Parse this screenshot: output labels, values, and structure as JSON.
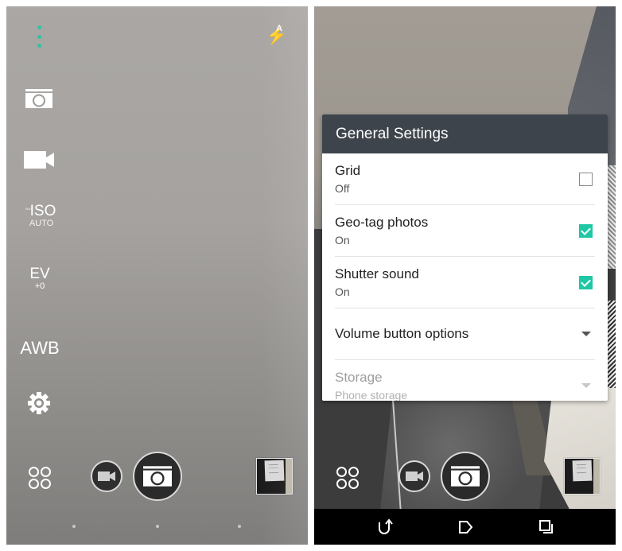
{
  "left_screen": {
    "top_bar": {
      "menu_icon": "vertical-dots-icon",
      "flash_icon": "flash-auto-icon",
      "flash_label": "A",
      "flash_glyph": "⚡"
    },
    "side_menu": {
      "photo_mode_icon": "camera-icon",
      "video_mode_icon": "video-camera-icon",
      "iso": {
        "max_label": "MAX",
        "label": "ISO",
        "value": "AUTO"
      },
      "ev": {
        "label": "EV",
        "value": "+0"
      },
      "white_balance": {
        "label": "AWB"
      },
      "settings_icon": "gear-icon"
    },
    "bottom_bar": {
      "apps_icon": "modes-grid-icon",
      "video_button_icon": "video-camera-icon",
      "shutter_button_icon": "camera-icon",
      "gallery_thumbnail": "last-photo-thumbnail"
    },
    "page_indicator_count": 3
  },
  "right_screen": {
    "dialog": {
      "title": "General Settings",
      "items": [
        {
          "title": "Grid",
          "value": "Off",
          "control": "checkbox",
          "checked": false
        },
        {
          "title": "Geo-tag photos",
          "value": "On",
          "control": "checkbox",
          "checked": true
        },
        {
          "title": "Shutter sound",
          "value": "On",
          "control": "checkbox",
          "checked": true
        },
        {
          "title": "Volume button options",
          "control": "dropdown"
        },
        {
          "title": "Storage",
          "value": "Phone storage",
          "control": "dropdown",
          "disabled": true
        }
      ]
    },
    "bottom_bar": {
      "apps_icon": "modes-grid-icon",
      "video_button_icon": "video-camera-icon",
      "shutter_button_icon": "camera-icon",
      "gallery_thumbnail": "last-photo-thumbnail"
    },
    "nav_bar": {
      "back_icon": "back-icon",
      "home_icon": "home-icon",
      "recents_icon": "recents-icon"
    }
  },
  "colors": {
    "accent": "#1fc7a5",
    "dialog_header": "#3e444c",
    "menu_dots": "#2ec4a0"
  }
}
